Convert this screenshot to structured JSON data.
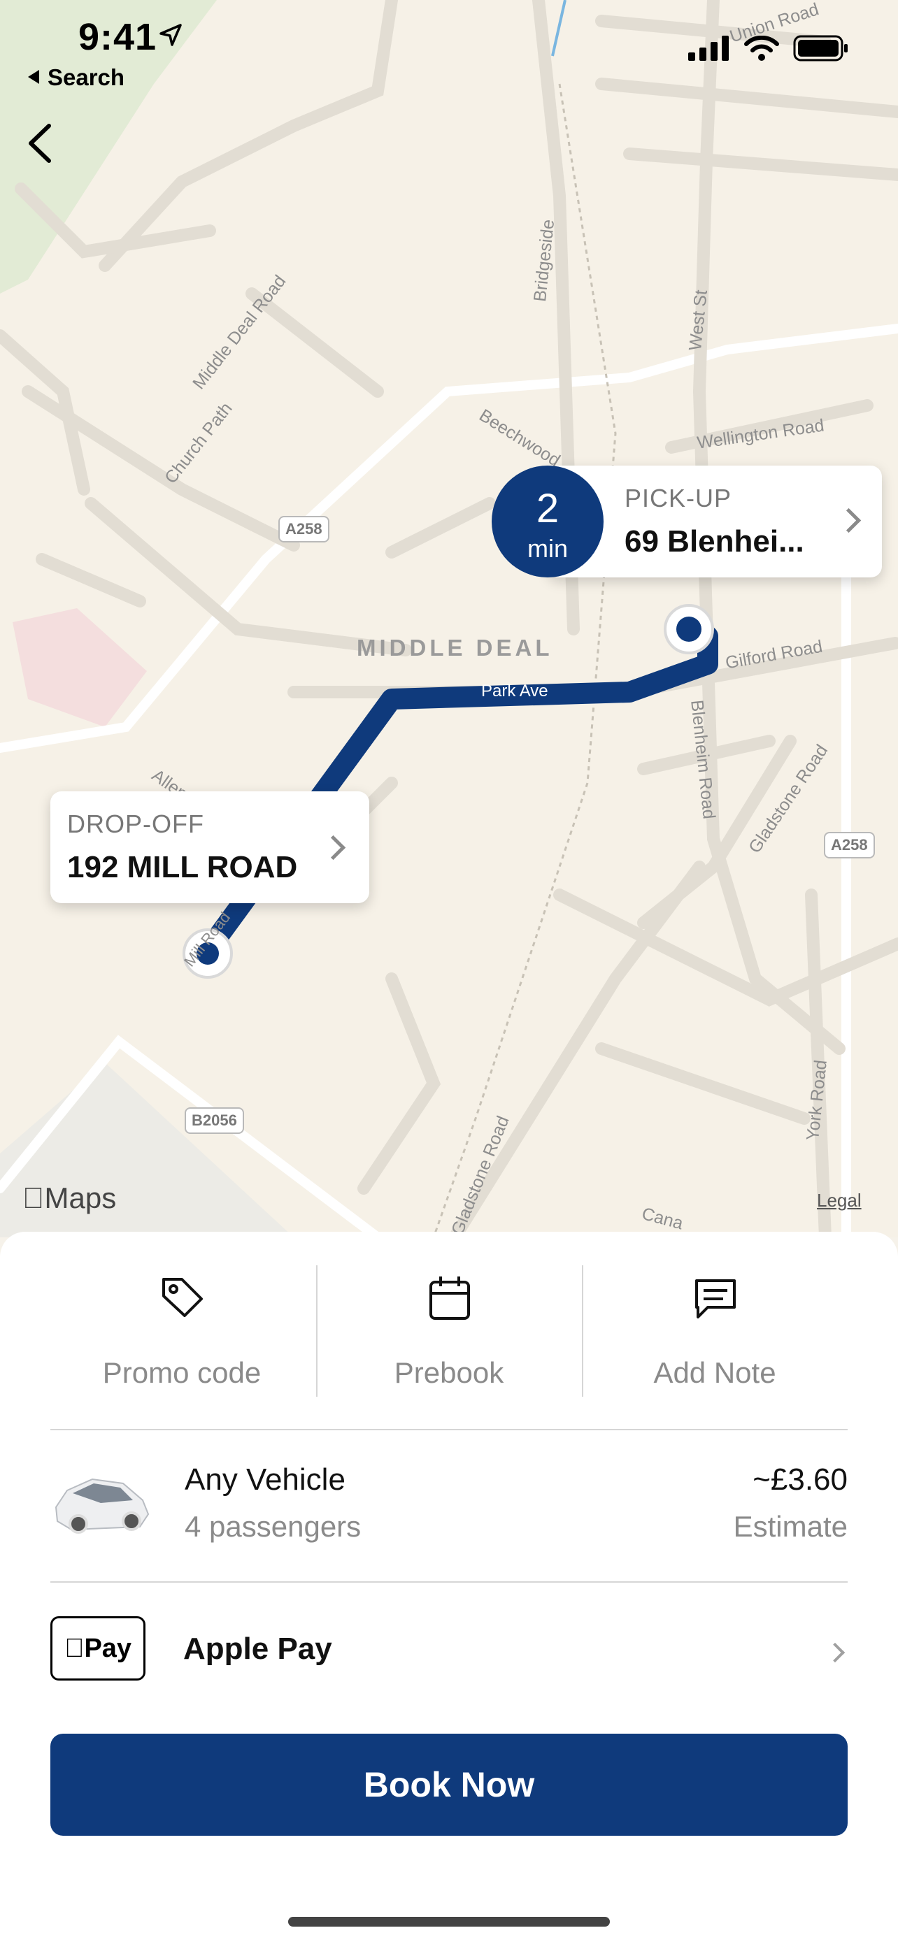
{
  "status_bar": {
    "time": "9:41",
    "back_app_label": "Search"
  },
  "map": {
    "area_label": "MIDDLE DEAL",
    "road_labels": [
      "Union Road",
      "Bridgeside",
      "West St",
      "Wellington Road",
      "Beechwood",
      "Middle Deal Road",
      "Church Path",
      "Gilford Road",
      "Park Ave",
      "Blenheim Road",
      "Gladstone Road",
      "York Road",
      "Allen",
      "Mill Road",
      "Gladstone Road",
      "Cana"
    ],
    "shields": [
      "A258",
      "A258",
      "B2056"
    ],
    "attribution": "Maps",
    "legal": "Legal",
    "route_color": "#0f3a7c"
  },
  "pickup": {
    "eta_value": "2",
    "eta_unit": "min",
    "label": "PICK-UP",
    "address": "69 Blenhei..."
  },
  "dropoff": {
    "label": "DROP-OFF",
    "address": "192 MILL ROAD"
  },
  "actions": [
    {
      "label": "Promo code",
      "icon": "tag-icon"
    },
    {
      "label": "Prebook",
      "icon": "calendar-icon"
    },
    {
      "label": "Add Note",
      "icon": "note-icon"
    }
  ],
  "vehicle": {
    "name": "Any Vehicle",
    "passengers": "4 passengers",
    "price": "~£3.60",
    "price_note": "Estimate"
  },
  "payment": {
    "badge": "Pay",
    "label": "Apple Pay"
  },
  "book_button": "Book Now",
  "colors": {
    "brand": "#0f3a7c",
    "map_bg": "#f6f1e7"
  }
}
